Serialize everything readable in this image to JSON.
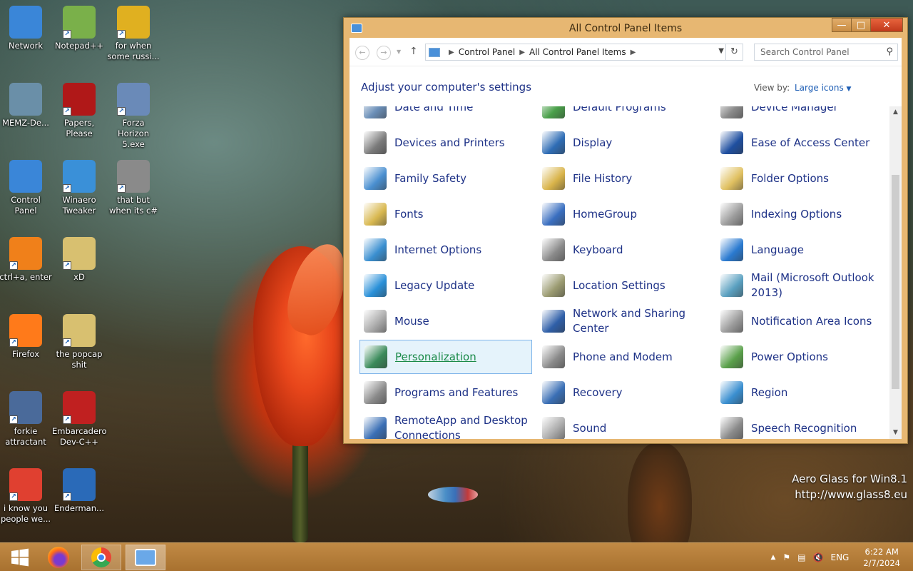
{
  "desktop": {
    "icons": [
      {
        "label": "Network"
      },
      {
        "label": "Notepad++"
      },
      {
        "label": "for when some russi..."
      },
      {
        "label": "MEMZ-De..."
      },
      {
        "label": "Papers, Please"
      },
      {
        "label": "Forza Horizon 5.exe"
      },
      {
        "label": "Control Panel"
      },
      {
        "label": "Winaero Tweaker"
      },
      {
        "label": "that but when its c#"
      },
      {
        "label": "ctrl+a, enter"
      },
      {
        "label": "xD"
      },
      {
        "label": "Firefox"
      },
      {
        "label": "the popcap shit"
      },
      {
        "label": "forkie attractant"
      },
      {
        "label": "Embarcadero Dev-C++"
      },
      {
        "label": "i know you people we..."
      },
      {
        "label": "Enderman..."
      }
    ],
    "watermark": {
      "line1": "Aero Glass for Win8.1",
      "line2": "http://www.glass8.eu"
    }
  },
  "window": {
    "title": "All Control Panel Items",
    "breadcrumb": [
      "Control Panel",
      "All Control Panel Items"
    ],
    "search_placeholder": "Search Control Panel",
    "heading": "Adjust your computer's settings",
    "view_by_label": "View by:",
    "view_by_value": "Large icons",
    "items": [
      {
        "label": "Date and Time",
        "color": "#6b8fb8"
      },
      {
        "label": "Default Programs",
        "color": "#4aa04a"
      },
      {
        "label": "Device Manager",
        "color": "#8a8a8a"
      },
      {
        "label": "Devices and Printers",
        "color": "#7a7a7a"
      },
      {
        "label": "Display",
        "color": "#2f6db5"
      },
      {
        "label": "Ease of Access Center",
        "color": "#1f4fa0"
      },
      {
        "label": "Family Safety",
        "color": "#4a8fd0"
      },
      {
        "label": "File History",
        "color": "#d9b44a"
      },
      {
        "label": "Folder Options",
        "color": "#e0c060"
      },
      {
        "label": "Fonts",
        "color": "#d8b850"
      },
      {
        "label": "HomeGroup",
        "color": "#3a6fc0"
      },
      {
        "label": "Indexing Options",
        "color": "#9a9a9a"
      },
      {
        "label": "Internet Options",
        "color": "#3a8fd0"
      },
      {
        "label": "Keyboard",
        "color": "#8a8a8a"
      },
      {
        "label": "Language",
        "color": "#2a7ad0"
      },
      {
        "label": "Legacy Update",
        "color": "#2a90d8"
      },
      {
        "label": "Location Settings",
        "color": "#9a9a70"
      },
      {
        "label": "Mail (Microsoft Outlook 2013)",
        "color": "#5aa0c0"
      },
      {
        "label": "Mouse",
        "color": "#aaaaaa"
      },
      {
        "label": "Network and Sharing Center",
        "color": "#2f5fa8"
      },
      {
        "label": "Notification Area Icons",
        "color": "#9a9a9a"
      },
      {
        "label": "Personalization",
        "color": "#3a8a5a"
      },
      {
        "label": "Phone and Modem",
        "color": "#8a8a8a"
      },
      {
        "label": "Power Options",
        "color": "#5aa04a"
      },
      {
        "label": "Programs and Features",
        "color": "#8a8a8a"
      },
      {
        "label": "Recovery",
        "color": "#3a6fb5"
      },
      {
        "label": "Region",
        "color": "#3a8fd0"
      },
      {
        "label": "RemoteApp and Desktop Connections",
        "color": "#3a6fb5"
      },
      {
        "label": "Sound",
        "color": "#aaaaaa"
      },
      {
        "label": "Speech Recognition",
        "color": "#8a8a8a"
      }
    ],
    "selected_item": "Personalization"
  },
  "taskbar": {
    "language": "ENG",
    "time": "6:22 AM",
    "date": "2/7/2024"
  },
  "colors": {
    "accent": "#e7b772",
    "link": "#1e3287"
  }
}
